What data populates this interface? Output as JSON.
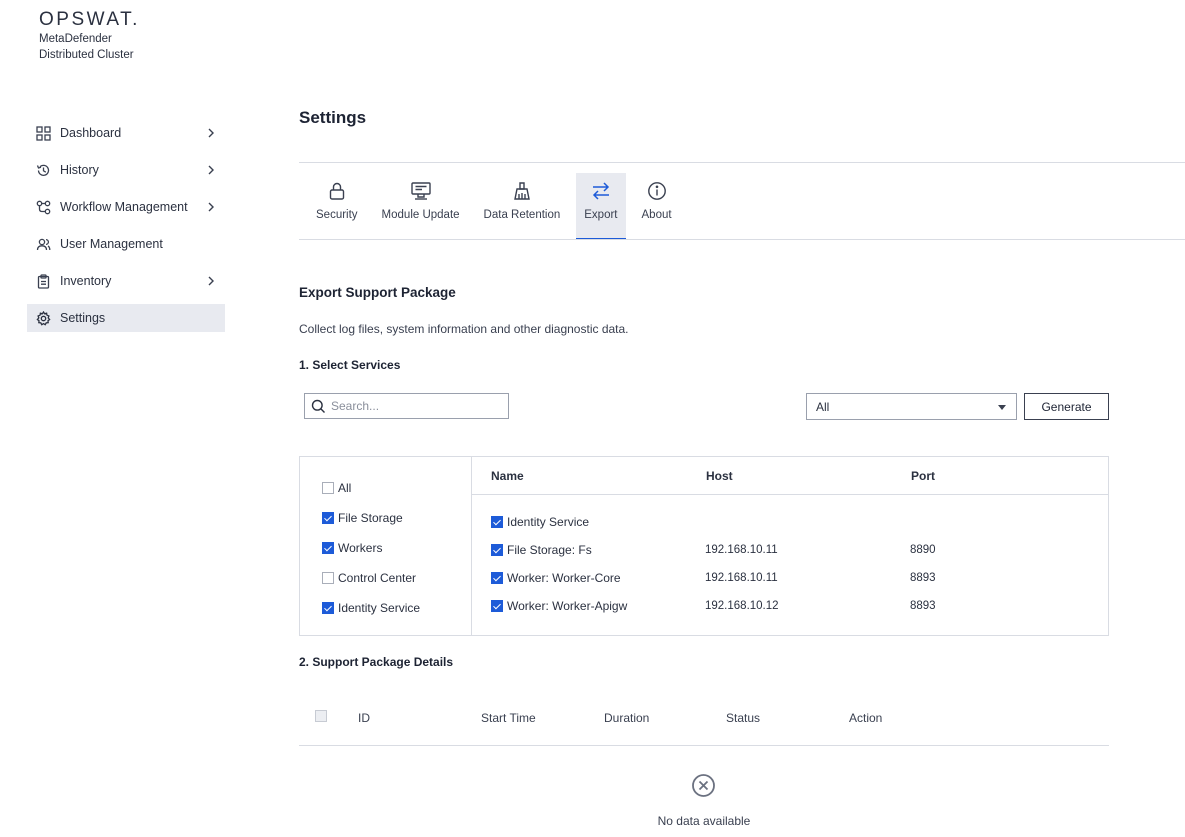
{
  "brand": {
    "logo": "OPSWAT.",
    "product_line1": "MetaDefender",
    "product_line2": "Distributed Cluster"
  },
  "sidebar": {
    "items": [
      {
        "label": "Dashboard",
        "icon": "dashboard-grid-icon",
        "has_chevron": true
      },
      {
        "label": "History",
        "icon": "history-icon",
        "has_chevron": true
      },
      {
        "label": "Workflow Management",
        "icon": "workflow-icon",
        "has_chevron": true
      },
      {
        "label": "User Management",
        "icon": "users-icon",
        "has_chevron": false
      },
      {
        "label": "Inventory",
        "icon": "clipboard-icon",
        "has_chevron": true
      },
      {
        "label": "Settings",
        "icon": "gear-icon",
        "has_chevron": false,
        "active": true
      }
    ]
  },
  "page": {
    "title": "Settings"
  },
  "tabs": [
    {
      "label": "Security",
      "icon": "lock-icon"
    },
    {
      "label": "Module Update",
      "icon": "module-update-icon"
    },
    {
      "label": "Data Retention",
      "icon": "broom-icon"
    },
    {
      "label": "Export",
      "icon": "arrows-exchange-icon",
      "active": true
    },
    {
      "label": "About",
      "icon": "info-icon"
    }
  ],
  "export": {
    "title": "Export Support Package",
    "description": "Collect log files, system information and other diagnostic data.",
    "step1": "1. Select Services",
    "search_placeholder": "Search...",
    "filter_select_value": "All",
    "generate_label": "Generate",
    "filters": [
      {
        "label": "All",
        "checked": false
      },
      {
        "label": "File Storage",
        "checked": true
      },
      {
        "label": "Workers",
        "checked": true
      },
      {
        "label": "Control Center",
        "checked": false
      },
      {
        "label": "Identity Service",
        "checked": true
      }
    ],
    "columns": {
      "name": "Name",
      "host": "Host",
      "port": "Port"
    },
    "services": [
      {
        "name": "Identity Service",
        "host": "",
        "port": "",
        "checked": true
      },
      {
        "name": "File Storage: Fs",
        "host": "192.168.10.11",
        "port": "8890",
        "checked": true
      },
      {
        "name": "Worker: Worker-Core",
        "host": "192.168.10.11",
        "port": "8893",
        "checked": true
      },
      {
        "name": "Worker: Worker-Apigw",
        "host": "192.168.10.12",
        "port": "8893",
        "checked": true
      }
    ],
    "step2": "2. Support Package Details",
    "package_columns": {
      "id": "ID",
      "start_time": "Start Time",
      "duration": "Duration",
      "status": "Status",
      "action": "Action"
    },
    "empty_text": "No data available"
  },
  "colors": {
    "accent": "#1d5bd8",
    "active_bg": "#e8eaf0",
    "border": "#d9dce3"
  }
}
